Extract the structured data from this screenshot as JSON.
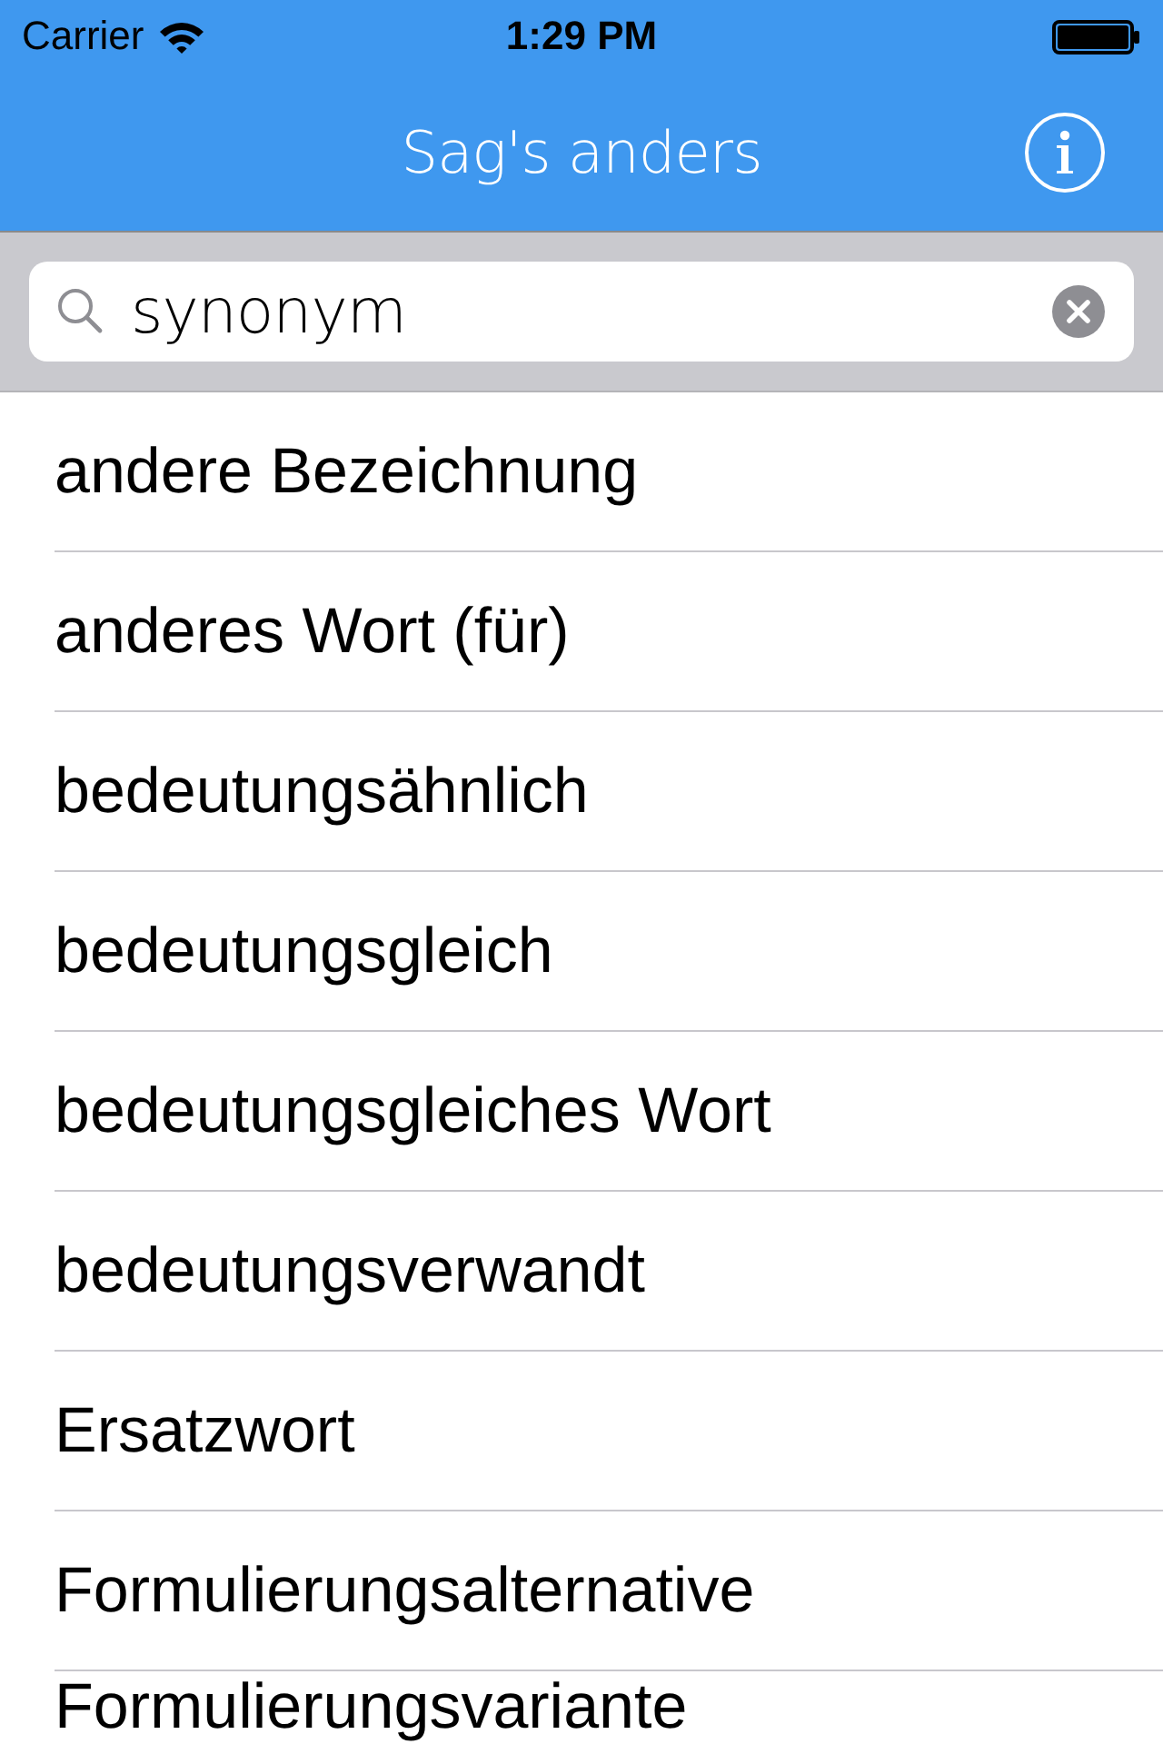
{
  "status_bar": {
    "carrier": "Carrier",
    "time": "1:29 PM"
  },
  "nav_bar": {
    "title": "Sag's anders"
  },
  "search": {
    "value": "synonym"
  },
  "results": [
    "andere Bezeichnung",
    "anderes Wort (für)",
    "bedeutungsähnlich",
    "bedeutungsgleich",
    "bedeutungsgleiches Wort",
    "bedeutungsverwandt",
    "Ersatzwort",
    "Formulierungsalternative",
    "Formulierungsvariante"
  ]
}
